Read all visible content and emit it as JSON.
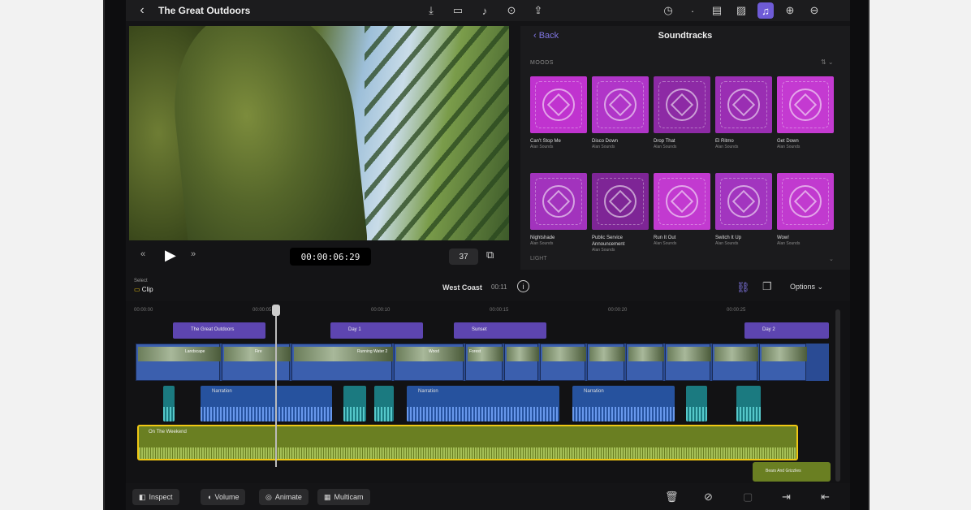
{
  "topbar": {
    "project_title": "The Great Outdoors",
    "back_glyph": "‹",
    "mid_icons": [
      "camera-import-icon",
      "video-camera-icon",
      "microphone-icon",
      "voiceover-icon",
      "share-icon"
    ],
    "right_icons": [
      "clock-icon",
      "dot-icon",
      "photos-icon",
      "image-icon",
      "soundtracks-icon",
      "plus-icon",
      "minus-icon"
    ],
    "mid_glyphs": [
      "⤓",
      "▭",
      "♪",
      "⊙",
      "⇪"
    ],
    "right_glyphs": [
      "◷",
      "·",
      "▤",
      "▨",
      "♫",
      "⊕",
      "⊖"
    ]
  },
  "viewer": {
    "skip_back": "«",
    "play": "▶",
    "skip_forward": "»",
    "timecode": "00:00:06:29",
    "zoom": "37",
    "screen_glyph": "⧉"
  },
  "browser": {
    "back_label": "‹ Back",
    "title": "Soundtracks",
    "section": "MOODS",
    "sort": "⇅ ⌄",
    "footer_left": "LIGHT",
    "footer_right": "⌄",
    "tracks": [
      {
        "title": "Can't Stop Me",
        "artist": "Alan Sounds",
        "color": "#c033cf"
      },
      {
        "title": "Disco Down",
        "artist": "Alan Sounds",
        "color": "#b035c8"
      },
      {
        "title": "Drop That",
        "artist": "Alan Sounds",
        "color": "#8d2aa5"
      },
      {
        "title": "El Ritmo",
        "artist": "Alan Sounds",
        "color": "#9a2eb3"
      },
      {
        "title": "Get Down",
        "artist": "Alan Sounds",
        "color": "#c43ad1"
      },
      {
        "title": "Nightshade",
        "artist": "Alan Sounds",
        "color": "#a233bd"
      },
      {
        "title": "Public Service Announcement",
        "artist": "Alan Sounds",
        "color": "#7e2596"
      },
      {
        "title": "Run It Out",
        "artist": "Alan Sounds",
        "color": "#c23ad0"
      },
      {
        "title": "Switch It Up",
        "artist": "Alan Sounds",
        "color": "#a235bf"
      },
      {
        "title": "Wow!",
        "artist": "Alan Sounds",
        "color": "#c13acf"
      }
    ]
  },
  "timeline_header": {
    "select_label": "Select",
    "clip_label": "Clip",
    "project_name": "West Coast",
    "duration": "00:11",
    "info_glyph": "i",
    "options_label": "Options ⌄"
  },
  "timeline": {
    "ruler": [
      "00:00:00",
      "00:00:05",
      "00:00:10",
      "00:00:15",
      "00:00:20",
      "00:00:25"
    ],
    "titles": [
      {
        "label": "The Great Outdoors"
      },
      {
        "label": "Day 1"
      },
      {
        "label": "Sunset"
      },
      {
        "label": "Day 2"
      }
    ],
    "video_clips": [
      "Landscape",
      "Fire",
      "Running Water 2",
      "Wood",
      "Forest",
      "",
      "",
      "",
      "",
      "",
      "",
      ""
    ],
    "narration": [
      "Narration",
      "Narration",
      "Narration",
      "Narration"
    ],
    "music": "On The Weekend",
    "sfx": "Bears And Grizzlies"
  },
  "bottombar": {
    "inspect": "Inspect",
    "volume": "Volume",
    "animate": "Animate",
    "multicam": "Multicam"
  }
}
